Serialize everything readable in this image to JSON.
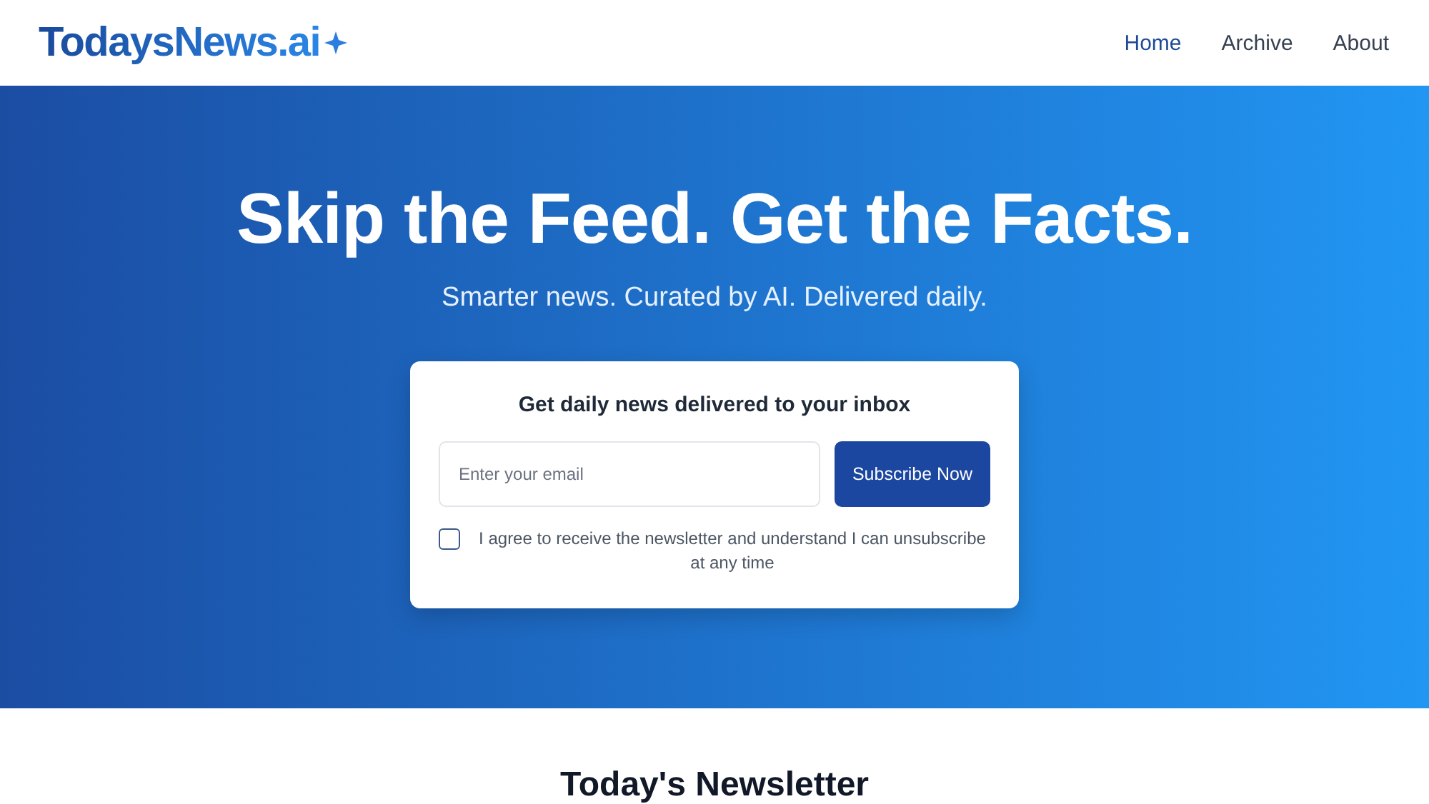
{
  "header": {
    "logo": "TodaysNews.ai",
    "nav": [
      {
        "label": "Home",
        "selected": true
      },
      {
        "label": "Archive",
        "selected": false
      },
      {
        "label": "About",
        "selected": false
      }
    ]
  },
  "hero": {
    "title": "Skip the Feed. Get the Facts.",
    "subtitle": "Smarter news. Curated by AI. Delivered daily."
  },
  "signup": {
    "title": "Get daily news delivered to your inbox",
    "email": {
      "placeholder": "Enter your email"
    },
    "button": "Subscribe Now",
    "consent": {
      "label": "I agree to receive the newsletter and understand I can unsubscribe at any time",
      "checked": false
    }
  },
  "newsletter": {
    "title": "Today's Newsletter"
  }
}
